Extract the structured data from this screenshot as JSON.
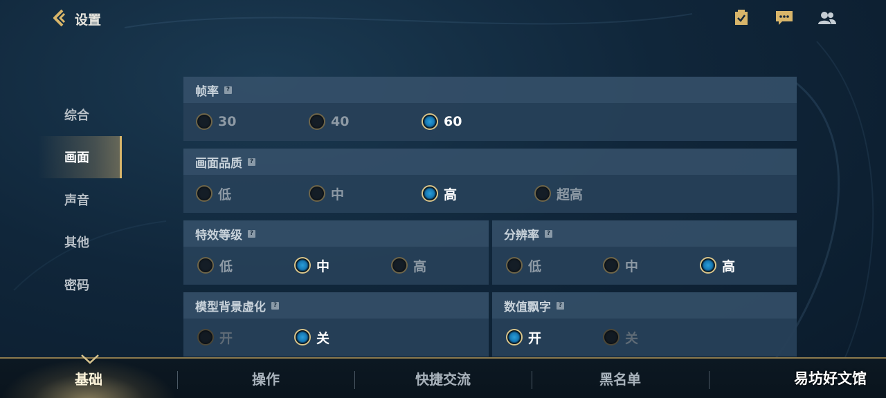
{
  "header": {
    "title": "设置",
    "icons": [
      "task-check-icon",
      "chat-bubble-icon",
      "friends-icon"
    ]
  },
  "side_nav": {
    "items": [
      {
        "label": "综合"
      },
      {
        "label": "画面"
      },
      {
        "label": "声音"
      },
      {
        "label": "其他"
      },
      {
        "label": "密码"
      }
    ],
    "active_index": 1
  },
  "settings": {
    "frame_rate": {
      "title": "帧率",
      "options": [
        "30",
        "40",
        "60"
      ],
      "selected": "60"
    },
    "quality": {
      "title": "画面品质",
      "options": [
        "低",
        "中",
        "高",
        "超高"
      ],
      "selected": "高"
    },
    "effects": {
      "title": "特效等级",
      "options": [
        "低",
        "中",
        "高"
      ],
      "selected": "中"
    },
    "resolution": {
      "title": "分辨率",
      "options": [
        "低",
        "中",
        "高"
      ],
      "selected": "高"
    },
    "model_blur": {
      "title": "模型背景虚化",
      "options": [
        "开",
        "关"
      ],
      "selected": "关"
    },
    "damage_text": {
      "title": "数值飘字",
      "options": [
        "开",
        "关"
      ],
      "selected": "开"
    }
  },
  "bottom_tabs": {
    "items": [
      "基础",
      "操作",
      "快捷交流",
      "黑名单",
      "易坊好文馆"
    ],
    "active_index": 0
  },
  "colors": {
    "accent_gold": "#d8b56a",
    "radio_selected": "#1677b3"
  }
}
